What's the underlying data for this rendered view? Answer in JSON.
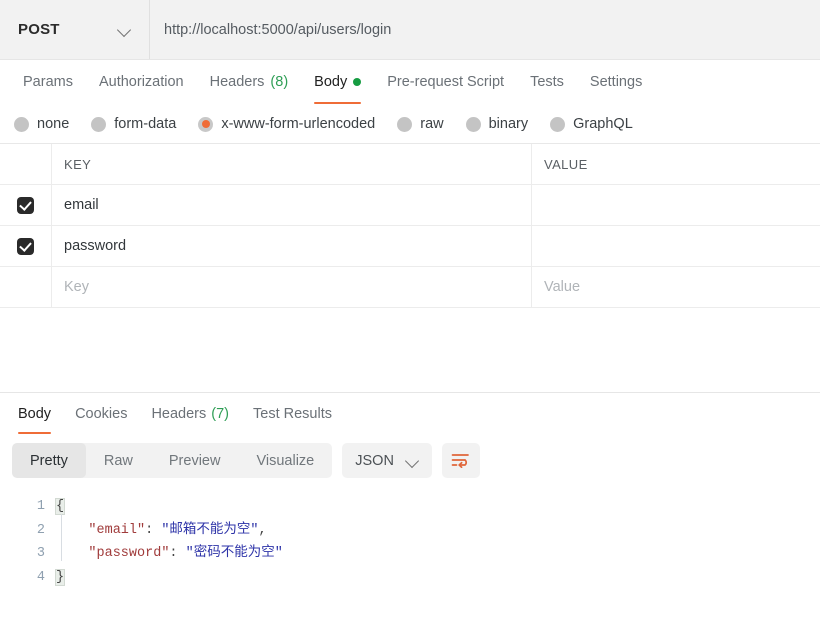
{
  "request": {
    "method": "POST",
    "url": "http://localhost:5000/api/users/login",
    "tabs": [
      {
        "label": "Params",
        "count": "",
        "active": false,
        "dot": false
      },
      {
        "label": "Authorization",
        "count": "",
        "active": false,
        "dot": false
      },
      {
        "label": "Headers",
        "count": "(8)",
        "active": false,
        "dot": false
      },
      {
        "label": "Body",
        "count": "",
        "active": true,
        "dot": true
      },
      {
        "label": "Pre-request Script",
        "count": "",
        "active": false,
        "dot": false
      },
      {
        "label": "Tests",
        "count": "",
        "active": false,
        "dot": false
      },
      {
        "label": "Settings",
        "count": "",
        "active": false,
        "dot": false
      }
    ],
    "body_types": [
      {
        "label": "none",
        "selected": false
      },
      {
        "label": "form-data",
        "selected": false
      },
      {
        "label": "x-www-form-urlencoded",
        "selected": true
      },
      {
        "label": "raw",
        "selected": false
      },
      {
        "label": "binary",
        "selected": false
      },
      {
        "label": "GraphQL",
        "selected": false
      }
    ],
    "table": {
      "columns": [
        "KEY",
        "VALUE"
      ],
      "rows": [
        {
          "checked": true,
          "key": "email",
          "value": ""
        },
        {
          "checked": true,
          "key": "password",
          "value": ""
        }
      ],
      "placeholder_row": {
        "key": "Key",
        "value": "Value"
      }
    }
  },
  "response": {
    "tabs": [
      {
        "label": "Body",
        "count": "",
        "active": true
      },
      {
        "label": "Cookies",
        "count": "",
        "active": false
      },
      {
        "label": "Headers",
        "count": "(7)",
        "active": false
      },
      {
        "label": "Test Results",
        "count": "",
        "active": false
      }
    ],
    "view_modes": [
      {
        "label": "Pretty",
        "active": true
      },
      {
        "label": "Raw",
        "active": false
      },
      {
        "label": "Preview",
        "active": false
      },
      {
        "label": "Visualize",
        "active": false
      }
    ],
    "format": "JSON",
    "wrap_icon": "word-wrap-icon",
    "code": {
      "line_numbers": [
        "1",
        "2",
        "3",
        "4"
      ],
      "lines": [
        {
          "n": "1",
          "open_brace": "{"
        },
        {
          "n": "2",
          "indent": "    ",
          "key": "\"email\"",
          "colon": ": ",
          "value": "\"邮箱不能为空\"",
          "comma": ","
        },
        {
          "n": "3",
          "indent": "    ",
          "key": "\"password\"",
          "colon": ": ",
          "value": "\"密码不能为空\"",
          "comma": ""
        },
        {
          "n": "4",
          "close_brace": "}"
        }
      ]
    }
  },
  "colors": {
    "accent_orange": "#ef6c37",
    "green": "#169c42",
    "count_green": "#2f9e56",
    "json_key": "#a03b3b",
    "json_string": "#2d33a8",
    "checkbox": "#2a2a2a"
  }
}
